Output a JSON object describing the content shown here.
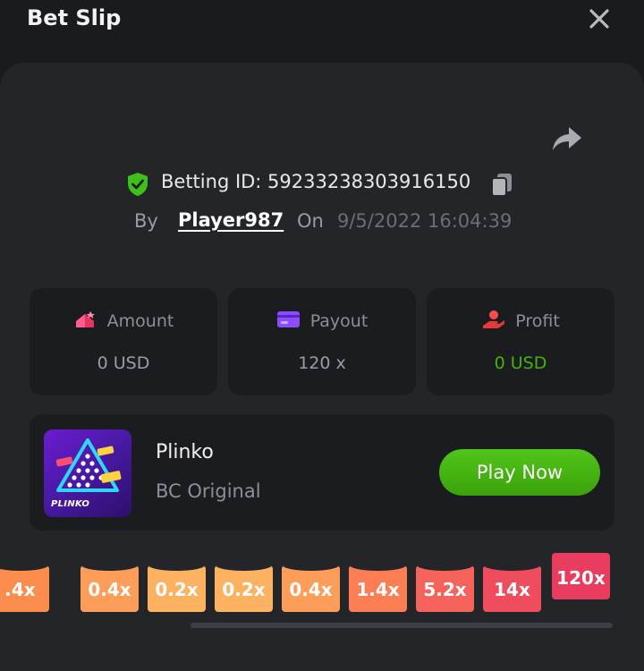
{
  "header": {
    "title": "Bet Slip",
    "close_icon": "close-icon"
  },
  "bet": {
    "id_label": "Betting ID: 59233238303916150",
    "by_label": "By",
    "player": "Player987",
    "on_label": "On",
    "datetime": "9/5/2022 16:04:39"
  },
  "stats": [
    {
      "label": "Amount",
      "value": "0 USD",
      "icon": "amount-icon"
    },
    {
      "label": "Payout",
      "value": "120 x",
      "icon": "payout-card-icon"
    },
    {
      "label": "Profit",
      "value": "0 USD",
      "icon": "profit-hand-icon",
      "value_color": "#43b309"
    }
  ],
  "game": {
    "name": "Plinko",
    "subtitle": "BC Original",
    "thumb_label": "PLINKO",
    "play_label": "Play Now"
  },
  "multipliers": [
    {
      "label": ".4x",
      "color": "#fc8d4d"
    },
    {
      "label": "0.4x",
      "color": "#fc9d5a"
    },
    {
      "label": "0.2x",
      "color": "#fcb260"
    },
    {
      "label": "0.2x",
      "color": "#fcb260"
    },
    {
      "label": "0.4x",
      "color": "#fc9d5a"
    },
    {
      "label": "1.4x",
      "color": "#fb7e54"
    },
    {
      "label": "5.2x",
      "color": "#f6635a"
    },
    {
      "label": "14x",
      "color": "#ef4c5d"
    },
    {
      "label": "120x",
      "color": "#e83d5f",
      "active": true
    }
  ],
  "colors": {
    "accent_green": "#43b309",
    "background": "#1a1b1e",
    "panel": "#232528"
  }
}
